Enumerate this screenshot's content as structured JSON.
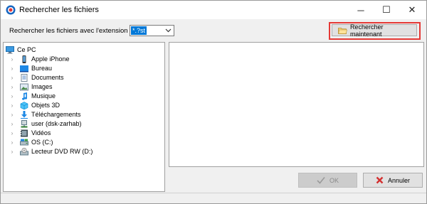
{
  "window": {
    "title": "Rechercher les fichiers",
    "icon": "app-logo-icon",
    "controls": {
      "minimize": "─",
      "maximize": "☐",
      "close": "✕"
    }
  },
  "toolbar": {
    "extension_label": "Rechercher les fichiers avec l'extension :",
    "extension_value": "*.?st",
    "search_button_label": "Rechercher maintenant",
    "highlight_color": "#e53935"
  },
  "tree": {
    "root": {
      "label": "Ce PC",
      "icon": "computer-icon"
    },
    "items": [
      {
        "label": "Apple iPhone",
        "icon": "phone-icon"
      },
      {
        "label": "Bureau",
        "icon": "desktop-folder-icon"
      },
      {
        "label": "Documents",
        "icon": "documents-folder-icon"
      },
      {
        "label": "Images",
        "icon": "pictures-folder-icon"
      },
      {
        "label": "Musique",
        "icon": "music-folder-icon"
      },
      {
        "label": "Objets 3D",
        "icon": "3d-objects-folder-icon"
      },
      {
        "label": "Téléchargements",
        "icon": "downloads-folder-icon"
      },
      {
        "label": "user (dsk-zarhab)",
        "icon": "network-user-icon"
      },
      {
        "label": "Vidéos",
        "icon": "videos-folder-icon"
      },
      {
        "label": "OS (C:)",
        "icon": "drive-icon"
      },
      {
        "label": "Lecteur DVD RW (D:)",
        "icon": "dvd-drive-icon"
      }
    ]
  },
  "footer": {
    "ok_label": "OK",
    "cancel_label": "Annuler"
  }
}
